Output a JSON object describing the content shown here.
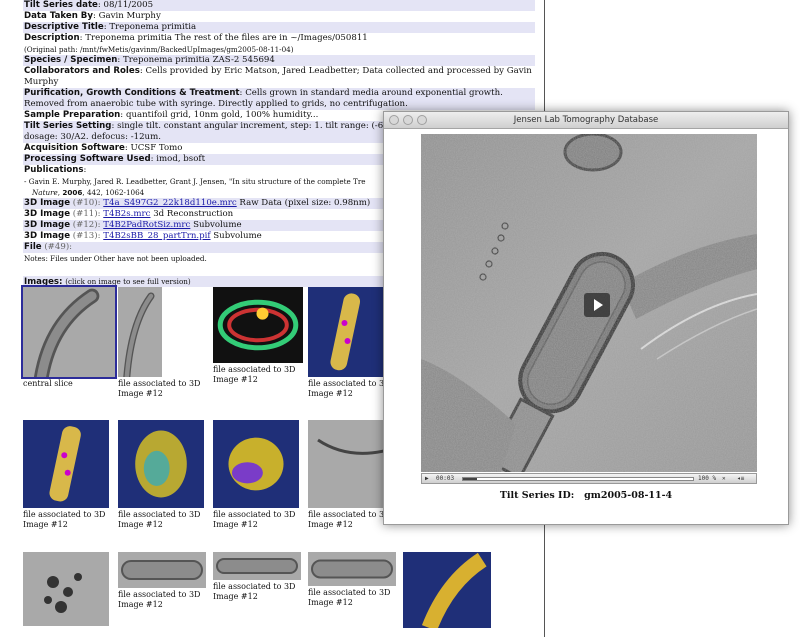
{
  "metadata": [
    {
      "label": "Tilt Series date",
      "value": "08/11/2005",
      "band": true
    },
    {
      "label": "Data Taken By",
      "value": "Gavin Murphy",
      "band": false
    },
    {
      "label": "Descriptive Title",
      "value": "Treponema primitia",
      "band": true
    },
    {
      "label": "Description",
      "value": "Treponema primitia The rest of the files are in ~/Images/050811",
      "band": false
    },
    {
      "label": "",
      "value": "(Original path: /mnt/fwMetis/gavinm/BackedUpImages/gm2005-08-11-04)",
      "band": false,
      "small": true
    },
    {
      "label": "Species / Specimen",
      "value": "Treponema primitia  ZAS-2  545694",
      "band": true
    },
    {
      "label": "Collaborators and Roles",
      "value": "Cells provided by Eric Matson, Jared Leadbetter; Data collected and processed by Gavin",
      "band": false
    },
    {
      "label": "",
      "value": "Murphy",
      "band": false
    },
    {
      "label": "Purification, Growth Conditions & Treatment",
      "value": "Cells grown in standard media around exponential growth.",
      "band": true
    },
    {
      "label": "",
      "value": "Removed from anaerobic tube with syringe. Directly applied to grids, no centrifugation.",
      "band": true
    },
    {
      "label": "Sample Preparation",
      "value": "quantifoil grid, 10nm gold, 100% humidity...",
      "band": false
    },
    {
      "label": "Tilt Series Setting",
      "value": "single tilt. constant angular increment, step: 1. tilt range: (-6",
      "band": true
    },
    {
      "label": "",
      "value": "        dosage: 30/A2. defocus: -12um.",
      "band": true
    },
    {
      "label": "Acquisition Software",
      "value": "UCSF Tomo",
      "band": false
    },
    {
      "label": "Processing Software Used",
      "value": "imod, bsoft",
      "band": true
    },
    {
      "label": "Publications",
      "value": "",
      "band": false
    }
  ],
  "publication": {
    "line1": "- Gavin E. Murphy, Jared R. Leadbetter, Grant J. Jensen, \"In situ structure of the complete Tre",
    "journal": "Nature",
    "year": "2006",
    "rest": ", 442, 1062-1064"
  },
  "files": [
    {
      "label": "3D Image",
      "num": "(#10):",
      "link": "T4a_S497G2_22k18d110e.mrc",
      "desc": "Raw Data (pixel size: 0.98nm)",
      "band": true
    },
    {
      "label": "3D Image",
      "num": "(#11):",
      "link": "T4B2s.mrc",
      "desc": "3d Reconstruction",
      "band": false
    },
    {
      "label": "3D Image",
      "num": "(#12):",
      "link": "T4B2PadRotSiz.mrc",
      "desc": "Subvolume",
      "band": true
    },
    {
      "label": "3D Image",
      "num": "(#13):",
      "link": "T4B2sBB_28_partTrn.pif",
      "desc": "Subvolume",
      "band": false
    },
    {
      "label": "File",
      "num": "(#49):",
      "link": "",
      "desc": "",
      "band": true
    }
  ],
  "notes": "Notes: Files under Other have not been uploaded.",
  "images_section": {
    "label": "Images:",
    "hint": "(click on image to see full version)"
  },
  "thumbnails": [
    {
      "caption": "central slice",
      "kind": "em",
      "selected": true
    },
    {
      "caption": "file associated to 3D Image #12",
      "kind": "em-narrow"
    },
    {
      "caption": "file associated to 3D Image #12",
      "kind": "render-dark"
    },
    {
      "caption": "file associated to 3D Image #12",
      "kind": "render-blue"
    },
    {
      "caption": "file associated to 3D Image #12",
      "kind": "render-blue"
    },
    {
      "caption": "file associated to 3D Image #12",
      "kind": "render-green"
    },
    {
      "caption": "file associated to 3D Image #12",
      "kind": "render-purple"
    },
    {
      "caption": "file associated to 3D Image #12",
      "kind": "em-noise"
    },
    {
      "caption": "",
      "kind": "em-particles"
    },
    {
      "caption": "file associated to 3D Image #12",
      "kind": "em-strip"
    },
    {
      "caption": "file associated to 3D Image #12",
      "kind": "em-strip"
    },
    {
      "caption": "file associated to 3D Image #12",
      "kind": "em-strip"
    },
    {
      "caption": "",
      "kind": "render-gold"
    }
  ],
  "window": {
    "title": "Jensen Lab Tomography Database",
    "time": "00:03",
    "volume": "100 %",
    "series_label": "Tilt Series ID:",
    "series_id": "gm2005-08-11-4"
  },
  "icons": [
    "play-icon",
    "close-icon",
    "volume-icon"
  ]
}
